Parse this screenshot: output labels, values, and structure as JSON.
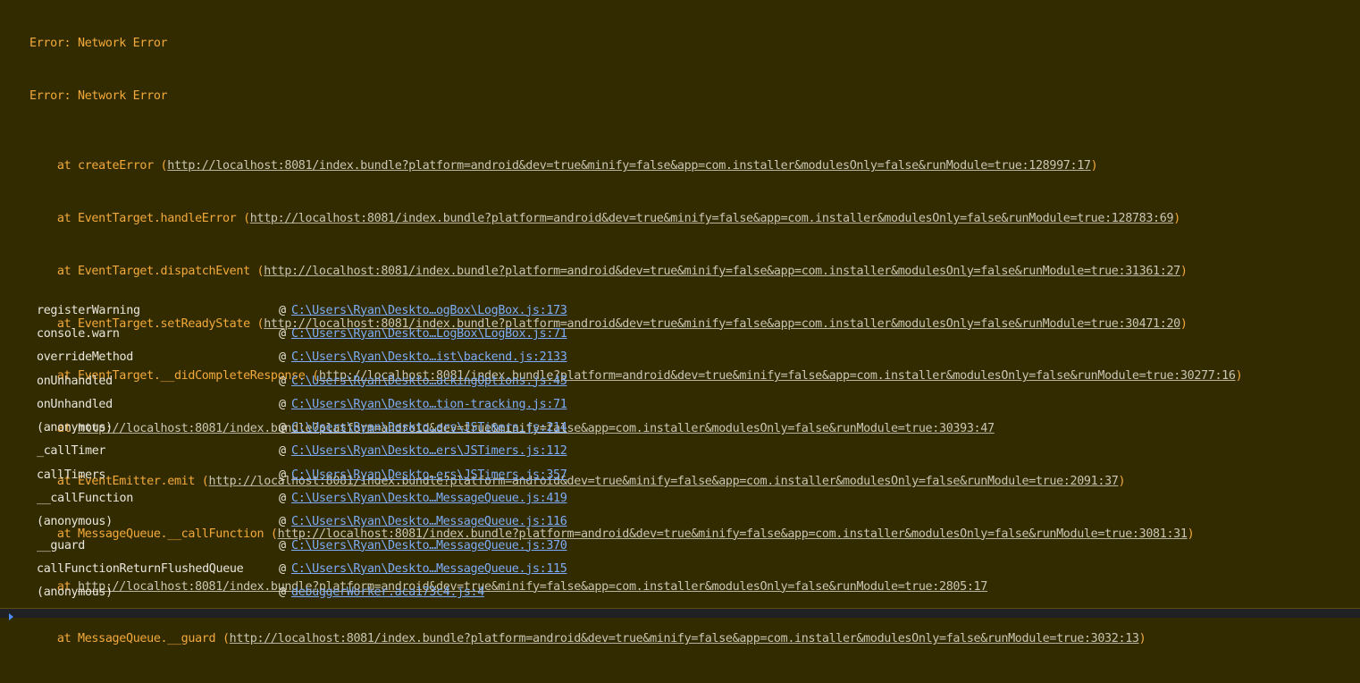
{
  "console": {
    "message_level": "warning",
    "colors": {
      "background": "#332b00",
      "warning_text": "#f2a93b",
      "link": "#7cacf8",
      "url": "#c9c5b4",
      "prompt_background": "#202124",
      "prompt_icon": "#4c8df6"
    },
    "header_lines": [
      "Error: Network Error",
      "Error: Network Error"
    ],
    "trace": [
      {
        "prefix": "    at createError (",
        "url": "http://localhost:8081/index.bundle?platform=android&dev=true&minify=false&app=com.installer&modulesOnly=false&runModule=true:128997:17",
        "suffix": ")"
      },
      {
        "prefix": "    at EventTarget.handleError (",
        "url": "http://localhost:8081/index.bundle?platform=android&dev=true&minify=false&app=com.installer&modulesOnly=false&runModule=true:128783:69",
        "suffix": ")"
      },
      {
        "prefix": "    at EventTarget.dispatchEvent (",
        "url": "http://localhost:8081/index.bundle?platform=android&dev=true&minify=false&app=com.installer&modulesOnly=false&runModule=true:31361:27",
        "suffix": ")"
      },
      {
        "prefix": "    at EventTarget.setReadyState (",
        "url": "http://localhost:8081/index.bundle?platform=android&dev=true&minify=false&app=com.installer&modulesOnly=false&runModule=true:30471:20",
        "suffix": ")"
      },
      {
        "prefix": "    at EventTarget.__didCompleteResponse (",
        "url": "http://localhost:8081/index.bundle?platform=android&dev=true&minify=false&app=com.installer&modulesOnly=false&runModule=true:30277:16",
        "suffix": ")"
      },
      {
        "prefix": "    at ",
        "url": "http://localhost:8081/index.bundle?platform=android&dev=true&minify=false&app=com.installer&modulesOnly=false&runModule=true:30393:47",
        "suffix": ""
      },
      {
        "prefix": "    at EventEmitter.emit (",
        "url": "http://localhost:8081/index.bundle?platform=android&dev=true&minify=false&app=com.installer&modulesOnly=false&runModule=true:2091:37",
        "suffix": ")"
      },
      {
        "prefix": "    at MessageQueue.__callFunction (",
        "url": "http://localhost:8081/index.bundle?platform=android&dev=true&minify=false&app=com.installer&modulesOnly=false&runModule=true:3081:31",
        "suffix": ")"
      },
      {
        "prefix": "    at ",
        "url": "http://localhost:8081/index.bundle?platform=android&dev=true&minify=false&app=com.installer&modulesOnly=false&runModule=true:2805:17",
        "suffix": ""
      },
      {
        "prefix": "    at MessageQueue.__guard (",
        "url": "http://localhost:8081/index.bundle?platform=android&dev=true&minify=false&app=com.installer&modulesOnly=false&runModule=true:3032:13",
        "suffix": ")"
      }
    ],
    "call_stack": [
      {
        "function": "registerWarning",
        "source": "C:\\Users\\Ryan\\Deskto…ogBox\\LogBox.js:173"
      },
      {
        "function": "console.warn",
        "source": "C:\\Users\\Ryan\\Deskto…LogBox\\LogBox.js:71"
      },
      {
        "function": "overrideMethod",
        "source": "C:\\Users\\Ryan\\Deskto…ist\\backend.js:2133"
      },
      {
        "function": "onUnhandled",
        "source": "C:\\Users\\Ryan\\Deskto…ackingOptions.js:43"
      },
      {
        "function": "onUnhandled",
        "source": "C:\\Users\\Ryan\\Deskto…tion-tracking.js:71"
      },
      {
        "function": "(anonymous)",
        "source": "C:\\Users\\Ryan\\Deskto…ers\\JSTimers.js:214"
      },
      {
        "function": "_callTimer",
        "source": "C:\\Users\\Ryan\\Deskto…ers\\JSTimers.js:112"
      },
      {
        "function": "callTimers",
        "source": "C:\\Users\\Ryan\\Deskto…ers\\JSTimers.js:357"
      },
      {
        "function": "__callFunction",
        "source": "C:\\Users\\Ryan\\Deskto…MessageQueue.js:419"
      },
      {
        "function": "(anonymous)",
        "source": "C:\\Users\\Ryan\\Deskto…MessageQueue.js:116"
      },
      {
        "function": "__guard",
        "source": "C:\\Users\\Ryan\\Deskto…MessageQueue.js:370"
      },
      {
        "function": "callFunctionReturnFlushedQueue",
        "source": "C:\\Users\\Ryan\\Deskto…MessageQueue.js:115"
      },
      {
        "function": "(anonymous)",
        "source": "debuggerWorker.aca173c4.js:4"
      }
    ],
    "at_symbol": "@",
    "prompt_icon": "chevron-right-icon"
  }
}
